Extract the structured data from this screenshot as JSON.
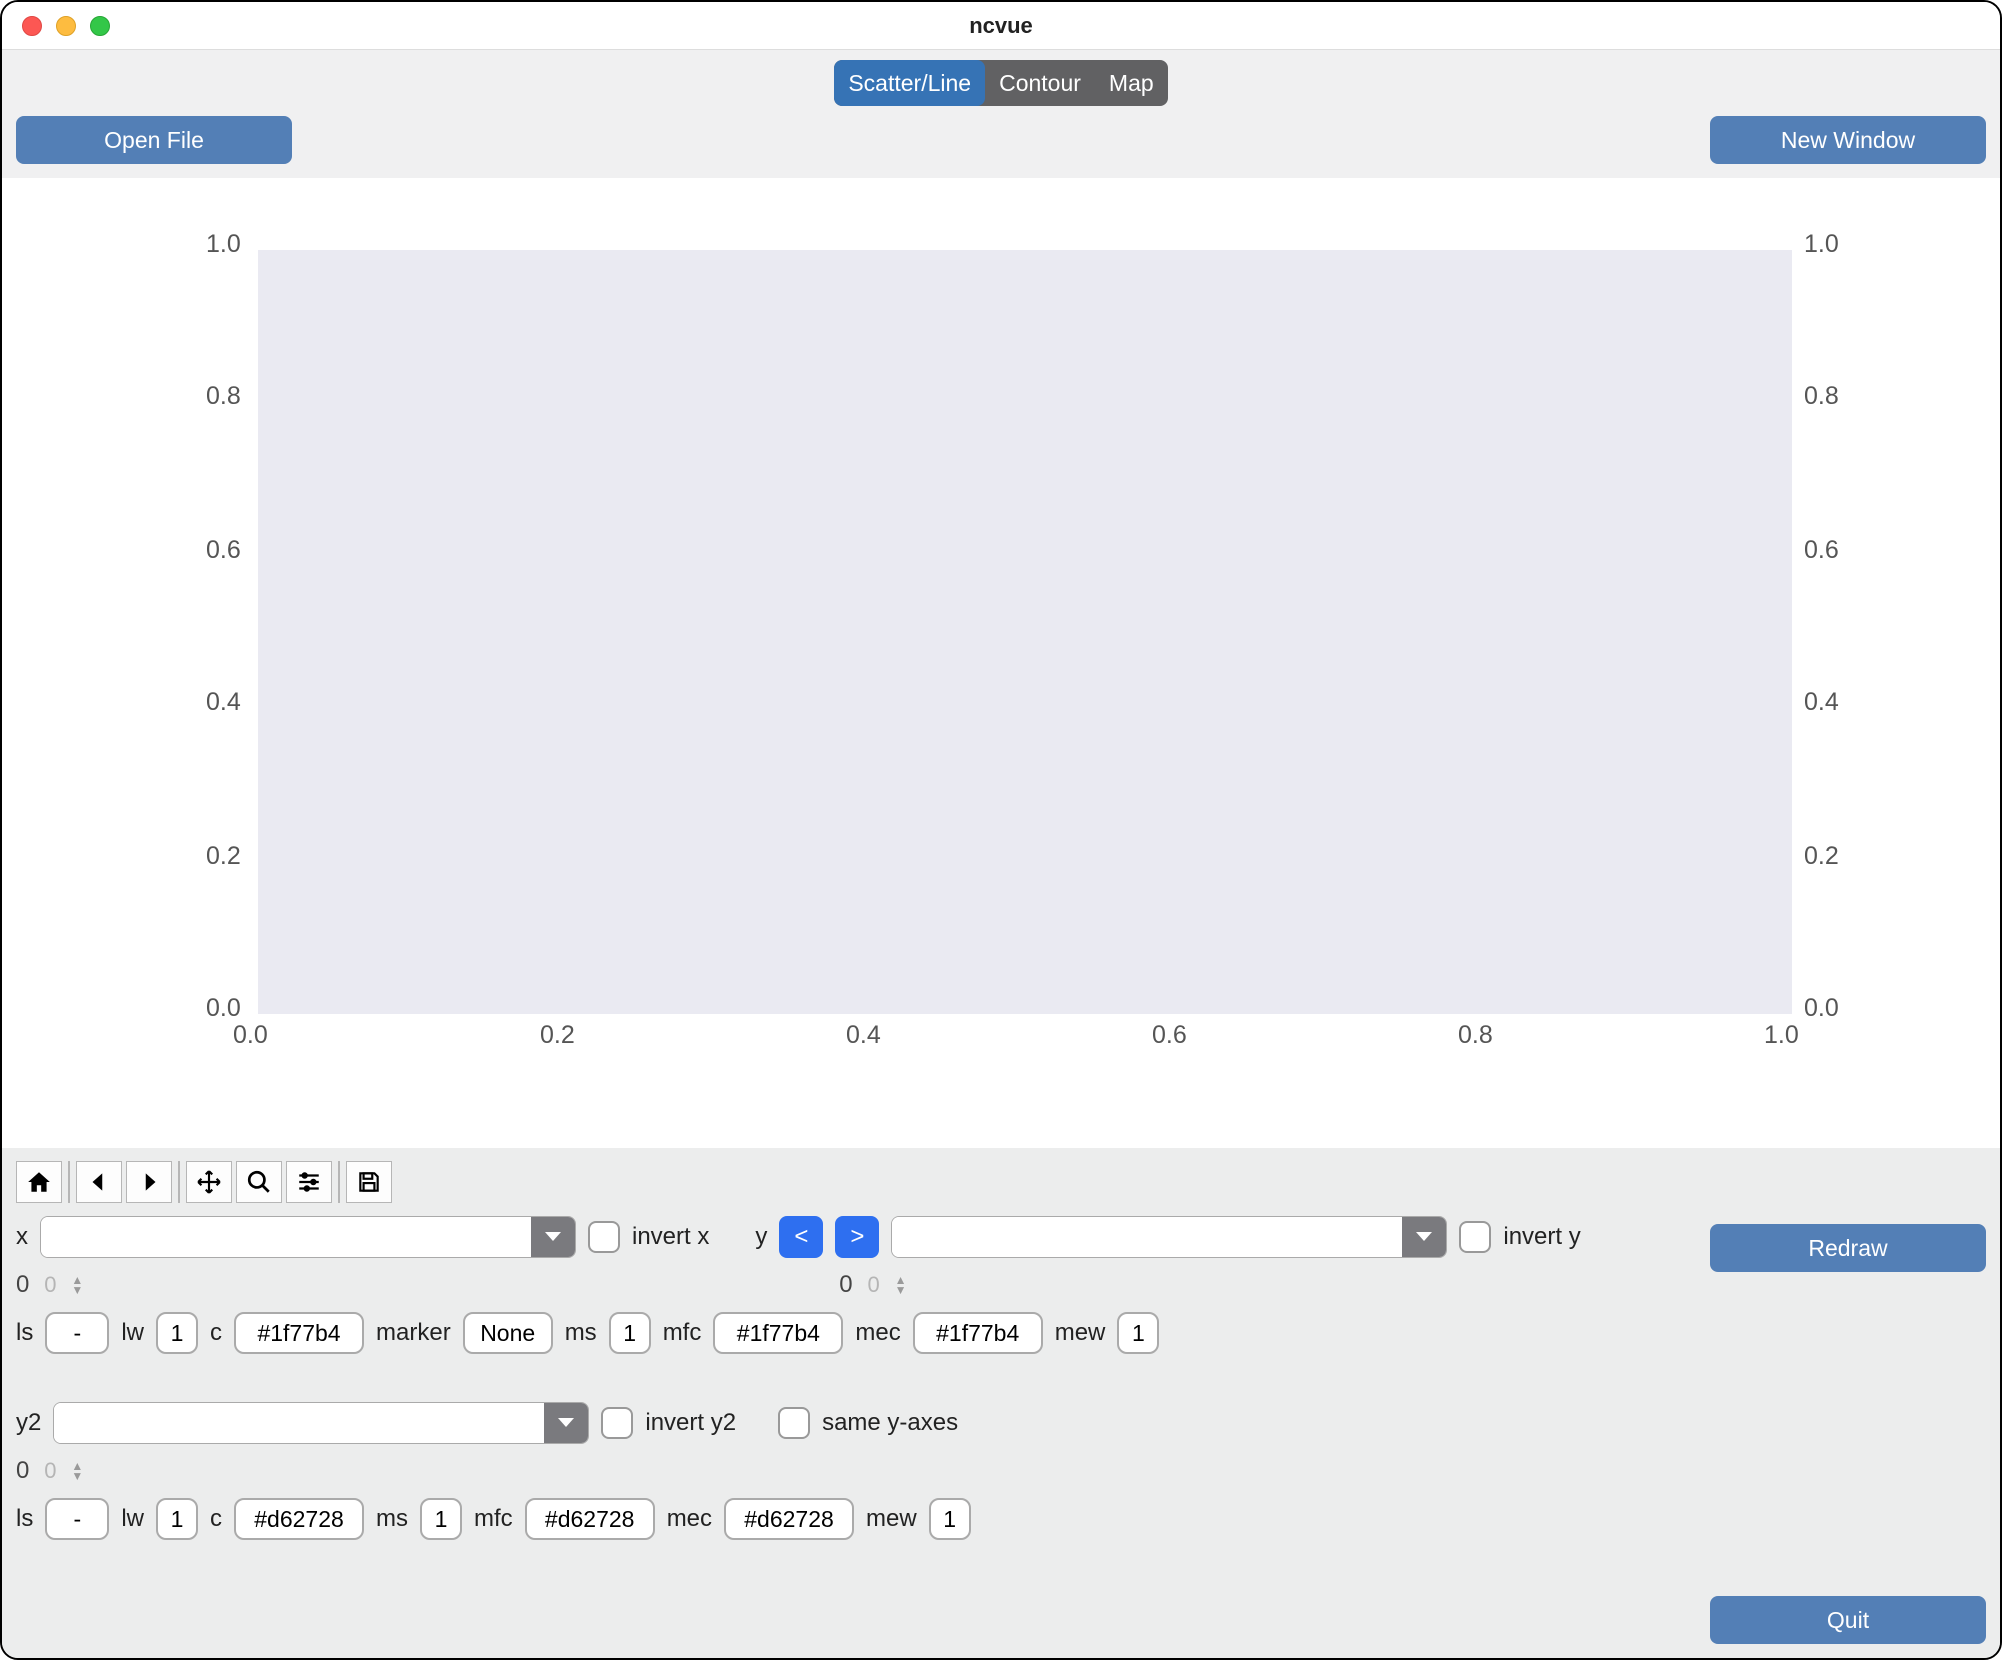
{
  "window": {
    "title": "ncvue"
  },
  "tabs": {
    "active": "Scatter/Line",
    "items": [
      "Scatter/Line",
      "Contour",
      "Map"
    ]
  },
  "header": {
    "open_file": "Open File",
    "new_window": "New Window"
  },
  "chart_data": {
    "type": "scatter",
    "x": [],
    "series": [],
    "title": "",
    "xlabel": "",
    "ylabel": "",
    "ylabel2": "",
    "xlim": [
      0.0,
      1.0
    ],
    "ylim": [
      0.0,
      1.0
    ],
    "ylim2": [
      0.0,
      1.0
    ],
    "xticks": [
      "0.0",
      "0.2",
      "0.4",
      "0.6",
      "0.8",
      "1.0"
    ],
    "yticks": [
      "0.0",
      "0.2",
      "0.4",
      "0.6",
      "0.8",
      "1.0"
    ],
    "y2ticks": [
      "0.0",
      "0.2",
      "0.4",
      "0.6",
      "0.8",
      "1.0"
    ]
  },
  "controls": {
    "x": {
      "label": "x",
      "value": "",
      "invert": "invert x",
      "spinner_label": "0",
      "spinner_value": "0"
    },
    "y": {
      "label": "y",
      "value": "",
      "invert": "invert y",
      "spinner_label": "0",
      "spinner_value": "0",
      "prev": "<",
      "next": ">"
    },
    "style1": {
      "ls_label": "ls",
      "ls": "-",
      "lw_label": "lw",
      "lw": "1",
      "c_label": "c",
      "c": "#1f77b4",
      "marker_label": "marker",
      "marker": "None",
      "ms_label": "ms",
      "ms": "1",
      "mfc_label": "mfc",
      "mfc": "#1f77b4",
      "mec_label": "mec",
      "mec": "#1f77b4",
      "mew_label": "mew",
      "mew": "1"
    },
    "y2": {
      "label": "y2",
      "value": "",
      "invert": "invert y2",
      "same": "same y-axes",
      "spinner_label": "0",
      "spinner_value": "0"
    },
    "style2": {
      "ls_label": "ls",
      "ls": "-",
      "lw_label": "lw",
      "lw": "1",
      "c_label": "c",
      "c": "#d62728",
      "ms_label": "ms",
      "ms": "1",
      "mfc_label": "mfc",
      "mfc": "#d62728",
      "mec_label": "mec",
      "mec": "#d62728",
      "mew_label": "mew",
      "mew": "1"
    }
  },
  "actions": {
    "redraw": "Redraw",
    "quit": "Quit"
  }
}
